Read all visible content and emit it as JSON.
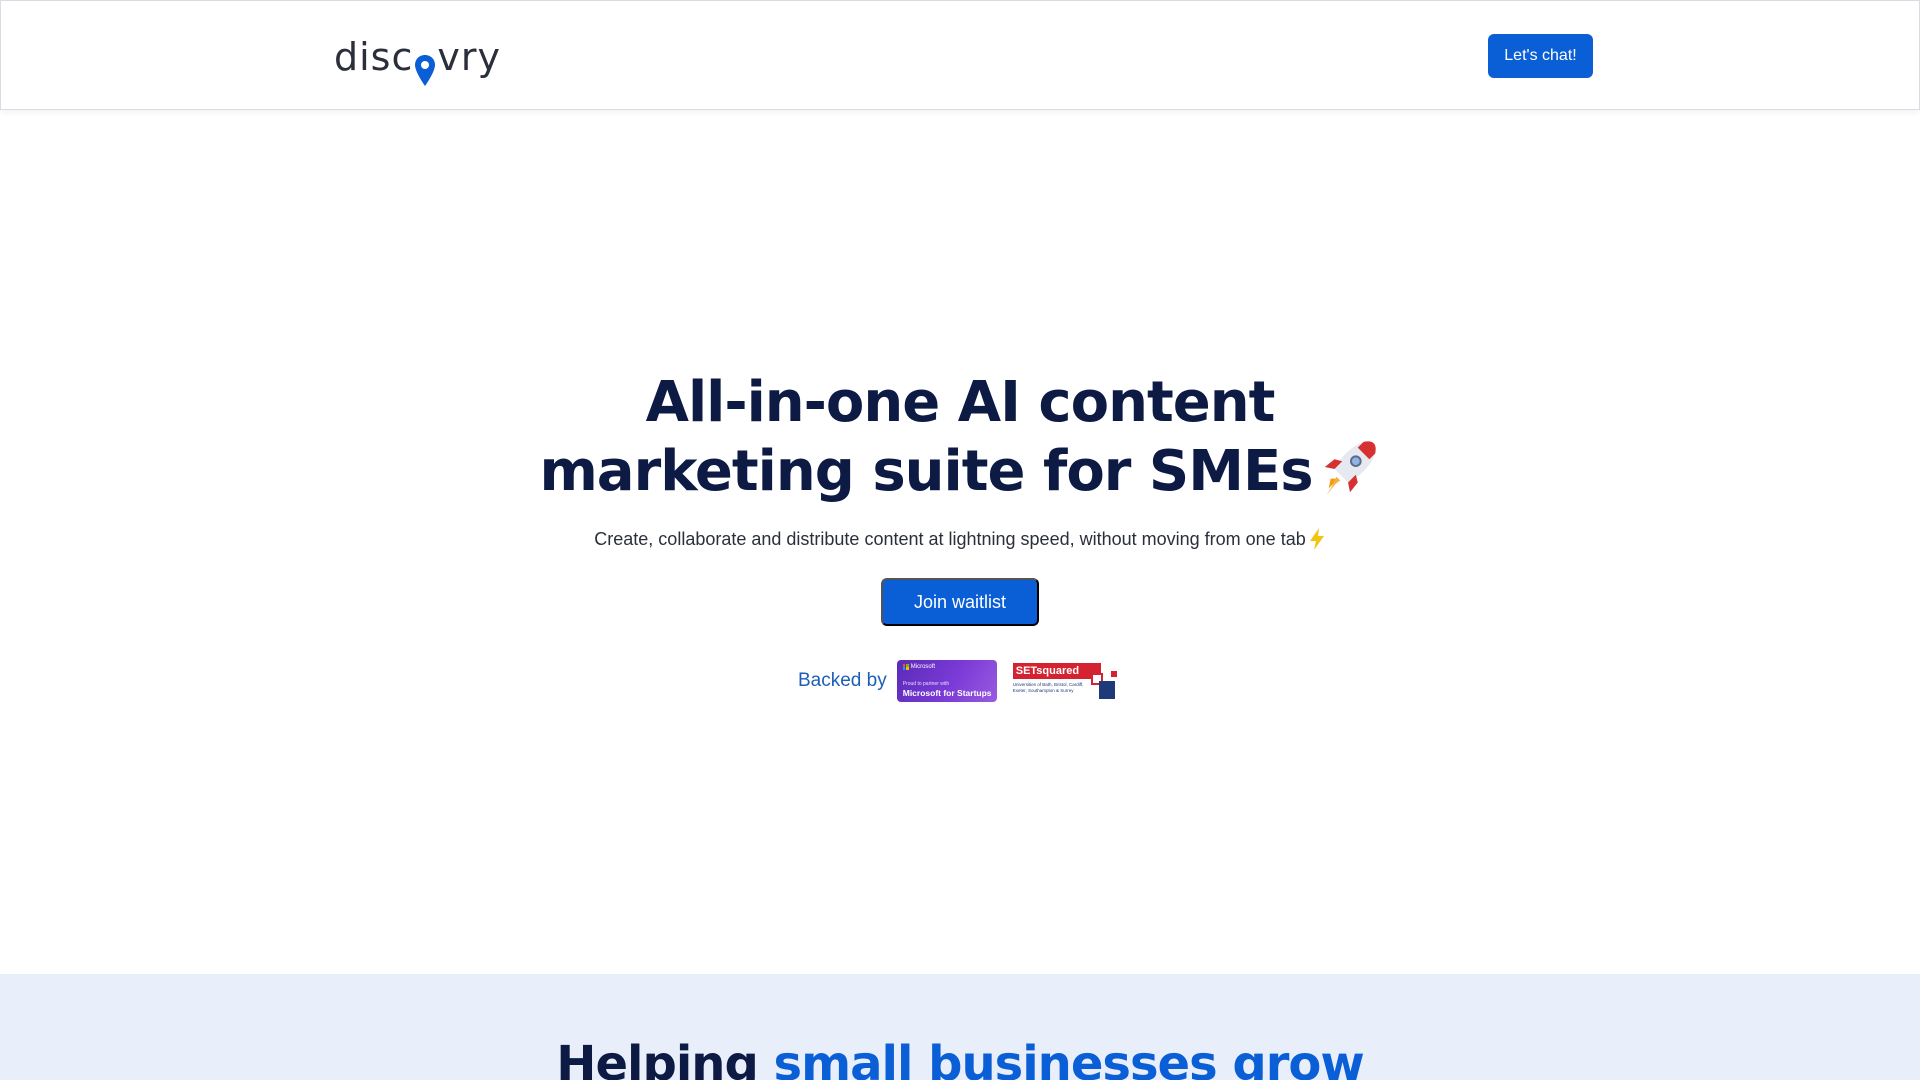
{
  "header": {
    "logo_text_start": "disc",
    "logo_text_end": "vry",
    "cta_label": "Let's chat!"
  },
  "hero": {
    "title_bold": "All-in-one",
    "title_rest_line1": " AI content",
    "title_line2": "marketing suite for SMEs",
    "subtitle": "Create, collaborate and distribute content at lightning speed, without moving from one tab",
    "join_label": "Join waitlist",
    "backed_label": "Backed by",
    "badges": {
      "microsoft_brand": "Microsoft",
      "microsoft_small": "Proud to partner with",
      "microsoft_main": "Microsoft for Startups",
      "setsquared_name": "SETsquared",
      "setsquared_text": "Universities of Bath, Bristol, Cardiff, Exeter, Southampton & Surrey"
    }
  },
  "section2": {
    "title_plain": "Helping ",
    "title_highlight": "small businesses grow"
  },
  "colors": {
    "accent": "#0b5fd6",
    "heading": "#0c1a44",
    "section_bg": "#e8effa"
  },
  "icons": [
    "location-pin-icon",
    "rocket-icon",
    "lightning-icon"
  ]
}
